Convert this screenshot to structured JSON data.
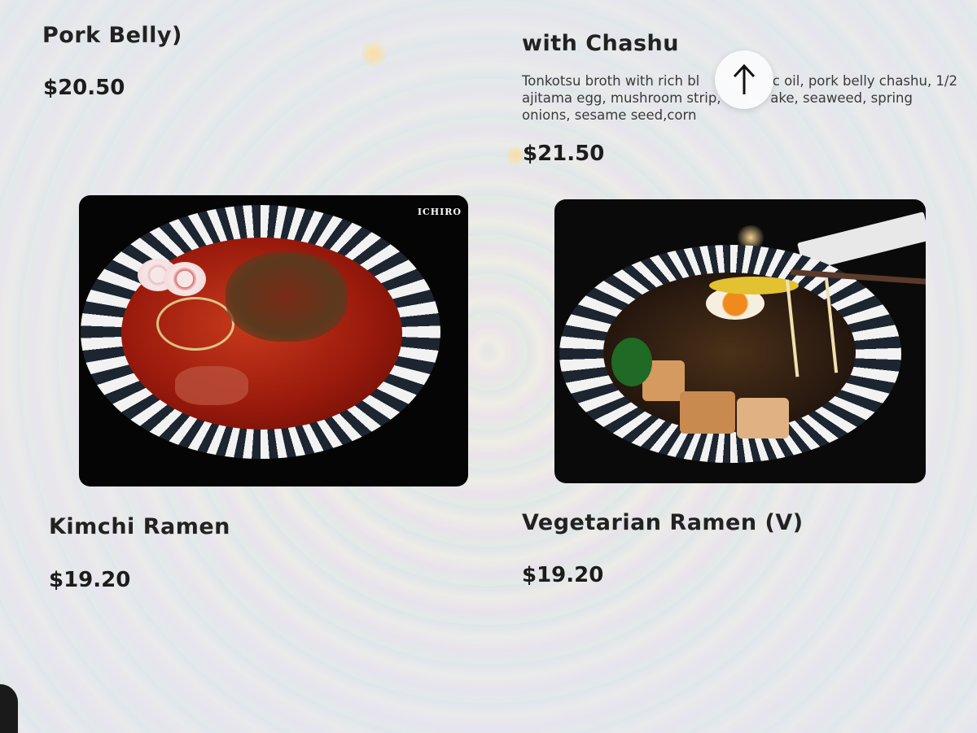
{
  "menu": {
    "items": [
      {
        "title": "Pork Belly)",
        "price": "$20.50"
      },
      {
        "title": "with Chashu",
        "description": "Tonkotsu broth with rich bl… c oil, pork belly chashu, 1/2 ajitama egg, mushroom strip… ake, seaweed, spring onions, sesame seed,corn",
        "desc_line1": "Tonkotsu broth with rich bl",
        "desc_line1b": "c oil, pork belly chashu, 1/2",
        "desc_line2": "ajitama egg, mushroom strip,",
        "desc_line2b": "ake, seaweed, spring",
        "desc_line3": "onions, sesame seed,corn",
        "price": "$21.50"
      },
      {
        "title": "Kimchi Ramen",
        "price": "$19.20",
        "photo_logo": "ICHIRO"
      },
      {
        "title": "Vegetarian Ramen (V)",
        "price": "$19.20"
      }
    ]
  },
  "scroll_top_icon": "arrow-up-icon",
  "colors": {
    "broth_kimchi": "#9a1a0c",
    "broth_veg": "#2a1a10",
    "photo_bg": "#050505"
  }
}
